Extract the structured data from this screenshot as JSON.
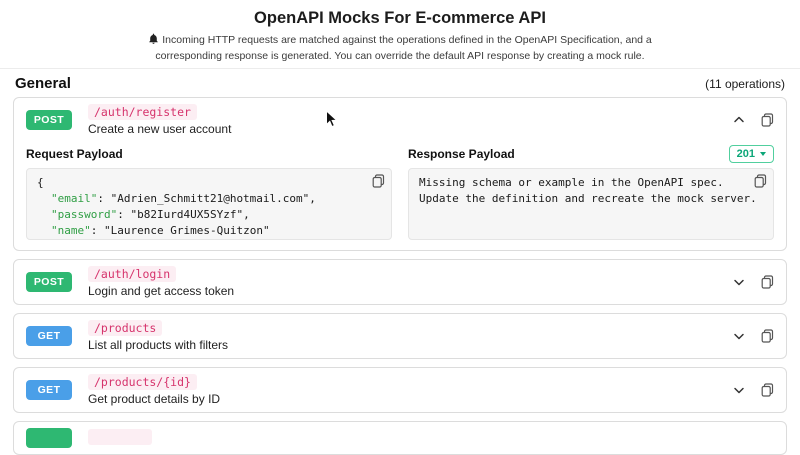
{
  "page": {
    "title": "OpenAPI Mocks For E-commerce API",
    "info_line1": "Incoming HTTP requests are matched against the operations defined in the OpenAPI Specification, and a",
    "info_line2": "corresponding response is generated. You can override the default API response by creating a mock rule.",
    "section_title": "General",
    "operations_count": "(11 operations)"
  },
  "operations": [
    {
      "method": "POST",
      "path": "/auth/register",
      "description": "Create a new user account",
      "request": {
        "title": "Request Payload",
        "code": {
          "open_brace": "{",
          "lines": [
            {
              "key": "\"email\"",
              "sep": ": ",
              "value": "\"Adrien_Schmitt21@hotmail.com\"",
              "comma": ","
            },
            {
              "key": "\"password\"",
              "sep": ": ",
              "value": "\"b82Iurd4UX5SYzf\"",
              "comma": ","
            },
            {
              "key": "\"name\"",
              "sep": ": ",
              "value": "\"Laurence Grimes-Quitzon\"",
              "comma": ""
            }
          ],
          "close_brace": "}"
        }
      },
      "response": {
        "title": "Response Payload",
        "status_code": "201",
        "line1": "Missing schema or example in the OpenAPI spec.",
        "line2": "Update the definition and recreate the mock server."
      }
    },
    {
      "method": "POST",
      "path": "/auth/login",
      "description": "Login and get access token"
    },
    {
      "method": "GET",
      "path": "/products",
      "description": "List all products with filters"
    },
    {
      "method": "GET",
      "path": "/products/{id}",
      "description": "Get product details by ID"
    },
    {
      "method": "",
      "path": "",
      "description": ""
    }
  ],
  "colors": {
    "post_badge": "#2eb872",
    "get_badge": "#4a9fe8",
    "path_text": "#d6336c",
    "status_accent": "#0ca678"
  }
}
